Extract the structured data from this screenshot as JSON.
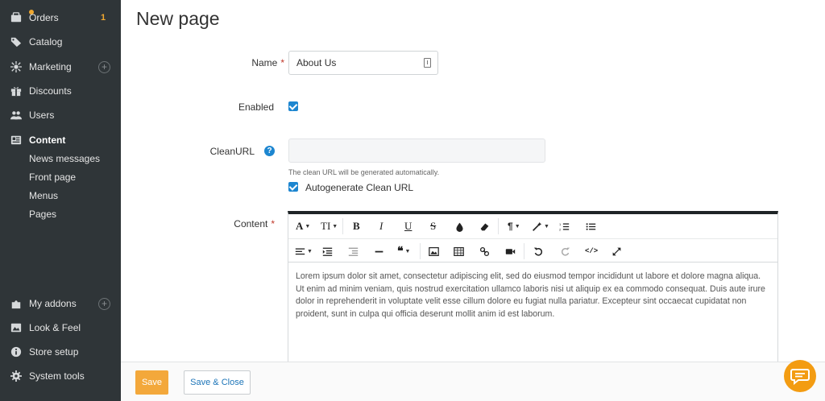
{
  "sidebar": {
    "items": [
      {
        "label": "Orders",
        "icon": "orders-icon",
        "badge": "1"
      },
      {
        "label": "Catalog",
        "icon": "tag-icon"
      },
      {
        "label": "Marketing",
        "icon": "marketing-icon"
      },
      {
        "label": "Discounts",
        "icon": "gift-icon"
      },
      {
        "label": "Users",
        "icon": "users-icon"
      },
      {
        "label": "Content",
        "icon": "content-icon",
        "active": true
      }
    ],
    "content_subitems": [
      "News messages",
      "Front page",
      "Menus",
      "Pages"
    ],
    "bottom_items": [
      {
        "label": "My addons",
        "icon": "puzzle-icon"
      },
      {
        "label": "Look & Feel",
        "icon": "image-icon"
      },
      {
        "label": "Store setup",
        "icon": "info-icon"
      },
      {
        "label": "System tools",
        "icon": "gear-icon"
      }
    ]
  },
  "page": {
    "title": "New page"
  },
  "form": {
    "name_label": "Name",
    "required_mark": "*",
    "name_value": "About Us",
    "enabled_label": "Enabled",
    "enabled_checked": true,
    "cleanurl_label": "CleanURL",
    "help_glyph": "?",
    "cleanurl_value": "",
    "cleanurl_hint": "The clean URL will be generated automatically.",
    "autogenerate_label": "Autogenerate Clean URL",
    "autogenerate_checked": true,
    "content_label": "Content"
  },
  "editor": {
    "toolbar_row1": [
      "font-icon",
      "text-size-icon",
      "bold-icon",
      "italic-icon",
      "underline-icon",
      "strikethrough-icon",
      "color-drop-icon",
      "eraser-icon",
      "paragraph-icon",
      "magic-wand-icon",
      "ordered-list-icon",
      "unordered-list-icon"
    ],
    "toolbar_row2": [
      "align-icon",
      "indent-icon",
      "outdent-icon",
      "horizontal-rule-icon",
      "quote-icon",
      "image-icon",
      "table-icon",
      "link-icon",
      "video-icon",
      "undo-icon",
      "redo-icon",
      "code-view-icon",
      "fullscreen-icon"
    ],
    "body_text": "Lorem ipsum dolor sit amet, consectetur adipiscing elit, sed do eiusmod tempor incididunt ut labore et dolore magna aliqua. Ut enim ad minim veniam, quis nostrud exercitation ullamco laboris nisi ut aliquip ex ea commodo consequat. Duis aute irure dolor in reprehenderit in voluptate velit esse cillum dolore eu fugiat nulla pariatur. Excepteur sint occaecat cupidatat non proident, sunt in culpa qui officia deserunt mollit anim id est laborum."
  },
  "footer": {
    "save_label": "Save",
    "save_close_label": "Save & Close"
  },
  "colors": {
    "sidebar_bg": "#2f3538",
    "accent_orange": "#f3a83b",
    "accent_blue": "#1d86d0"
  }
}
